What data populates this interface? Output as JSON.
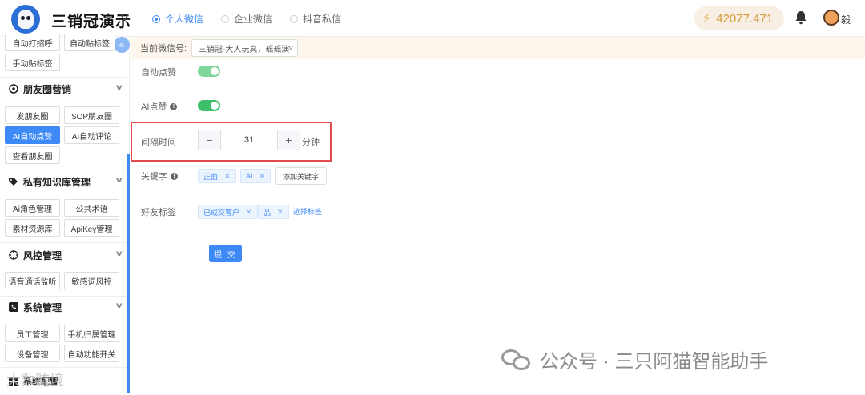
{
  "header": {
    "app_title": "三销冠演示",
    "radios": [
      {
        "label": "个人微信",
        "active": true
      },
      {
        "label": "企业微信",
        "active": false
      },
      {
        "label": "抖音私信",
        "active": false
      }
    ],
    "balance": "42077.471",
    "user_name": "毅"
  },
  "sidebar": {
    "top_chips": [
      "自动打招呼",
      "自动贴标签",
      "手动贴标签"
    ],
    "sections": [
      {
        "title": "朋友圈营销",
        "items": [
          "发朋友圈",
          "SOP朋友圈",
          "AI自动点赞",
          "AI自动评论",
          "查看朋友圈"
        ],
        "active": "AI自动点赞"
      },
      {
        "title": "私有知识库管理",
        "items": [
          "Ai角色管理",
          "公共术语",
          "素材资源库",
          "ApiKey管理"
        ]
      },
      {
        "title": "风控管理",
        "items": [
          "语音通话监听",
          "敏感词风控"
        ]
      },
      {
        "title": "系统管理",
        "items": [
          "员工管理",
          "手机归属管理",
          "设备管理",
          "自动功能开关"
        ]
      }
    ],
    "bottom_partial": "系统配置"
  },
  "main": {
    "current_wechat_label": "当前微信号:",
    "current_wechat_value": "三销冠-大人玩具，瑶瑶演",
    "auto_like_label": "自动点赞",
    "ai_like_label": "AI点赞",
    "interval_label": "间隔时间",
    "interval_value": "31",
    "interval_unit": "分钟",
    "keywords_label": "关键字",
    "keywords": [
      "正面",
      "AI"
    ],
    "add_keyword": "添加关键字",
    "friend_tags_label": "好友标签",
    "friend_tags": [
      "已成交客户",
      "品"
    ],
    "select_tags": "选择标签",
    "submit": "提 交"
  },
  "watermarks": {
    "wechat": "公众号 · 三只阿猫智能助手",
    "corner": "大数跨境"
  },
  "colors": {
    "accent": "#3d8af7",
    "switch_on": "#3dbf6a",
    "highlight": "#e24b4b",
    "balance": "#d09a3c"
  }
}
